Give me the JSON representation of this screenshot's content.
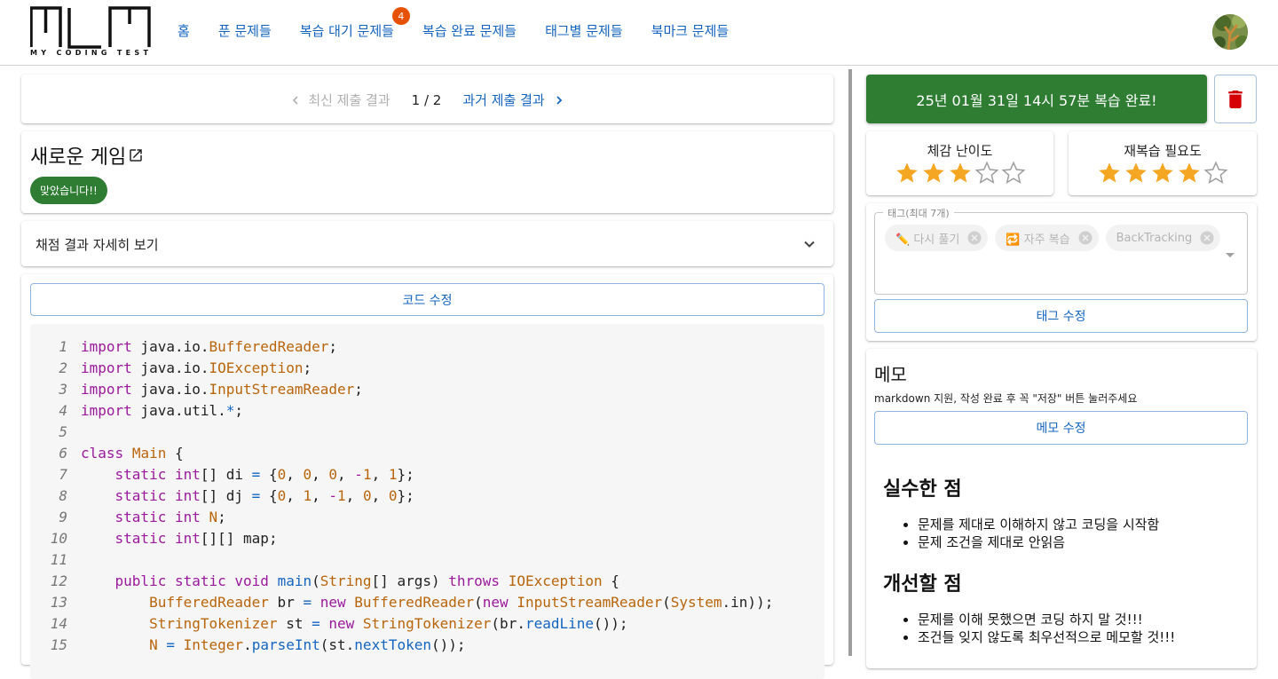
{
  "header": {
    "logo_text": "MY CODING TEST",
    "nav": [
      {
        "label": "홈"
      },
      {
        "label": "푼 문제들"
      },
      {
        "label": "복습 대기 문제들",
        "badge": "4"
      },
      {
        "label": "복습 완료 문제들"
      },
      {
        "label": "태그별 문제들"
      },
      {
        "label": "북마크 문제들"
      }
    ],
    "avatar_icon": "user-avatar-icon"
  },
  "pager": {
    "prev_label": "최신 제출 결과",
    "count": "1 / 2",
    "next_label": "과거 제출 결과"
  },
  "problem": {
    "title": "새로운 게임",
    "result_chip": "맞았습니다!!"
  },
  "accordion": {
    "label": "채점 결과 자세히 보기"
  },
  "code": {
    "edit_label": "코드 수정",
    "line_numbers": [
      "1",
      "2",
      "3",
      "4",
      "5",
      "6",
      "7",
      "8",
      "9",
      "10",
      "11",
      "12",
      "13",
      "14",
      "15"
    ]
  },
  "review": {
    "done_label": "25년 01월 31일 14시 57분 복습 완료!",
    "difficulty_label": "체감 난이도",
    "difficulty_value": 3,
    "need_label": "재복습 필요도",
    "need_value": 4,
    "max_stars": 5
  },
  "tags": {
    "legend": "태그(최대 7개)",
    "items": [
      "✏️ 다시 풀기",
      "🔁 자주 복습",
      "BackTracking"
    ],
    "edit_label": "태그 수정"
  },
  "memo": {
    "title": "메모",
    "hint": "markdown 지원, 작성 완료 후 꼭 \"저장\" 버튼 눌러주세요",
    "edit_label": "메모 수정",
    "h1": "실수한 점",
    "list1": [
      "문제를 제대로 이해하지 않고 코딩을 시작함",
      "문제 조건을 제대로 안읽음"
    ],
    "h2": "개선할 점",
    "list2": [
      "문제를 이해 못했으면 코딩 하지 말 것!!!",
      "조건들 잊지 않도록 최우선적으로 메모할 것!!!"
    ]
  },
  "colors": {
    "link": "#1565c0",
    "success": "#2e7d32",
    "badge": "#e65100",
    "star": "#f5a623",
    "delete": "#d50000"
  }
}
